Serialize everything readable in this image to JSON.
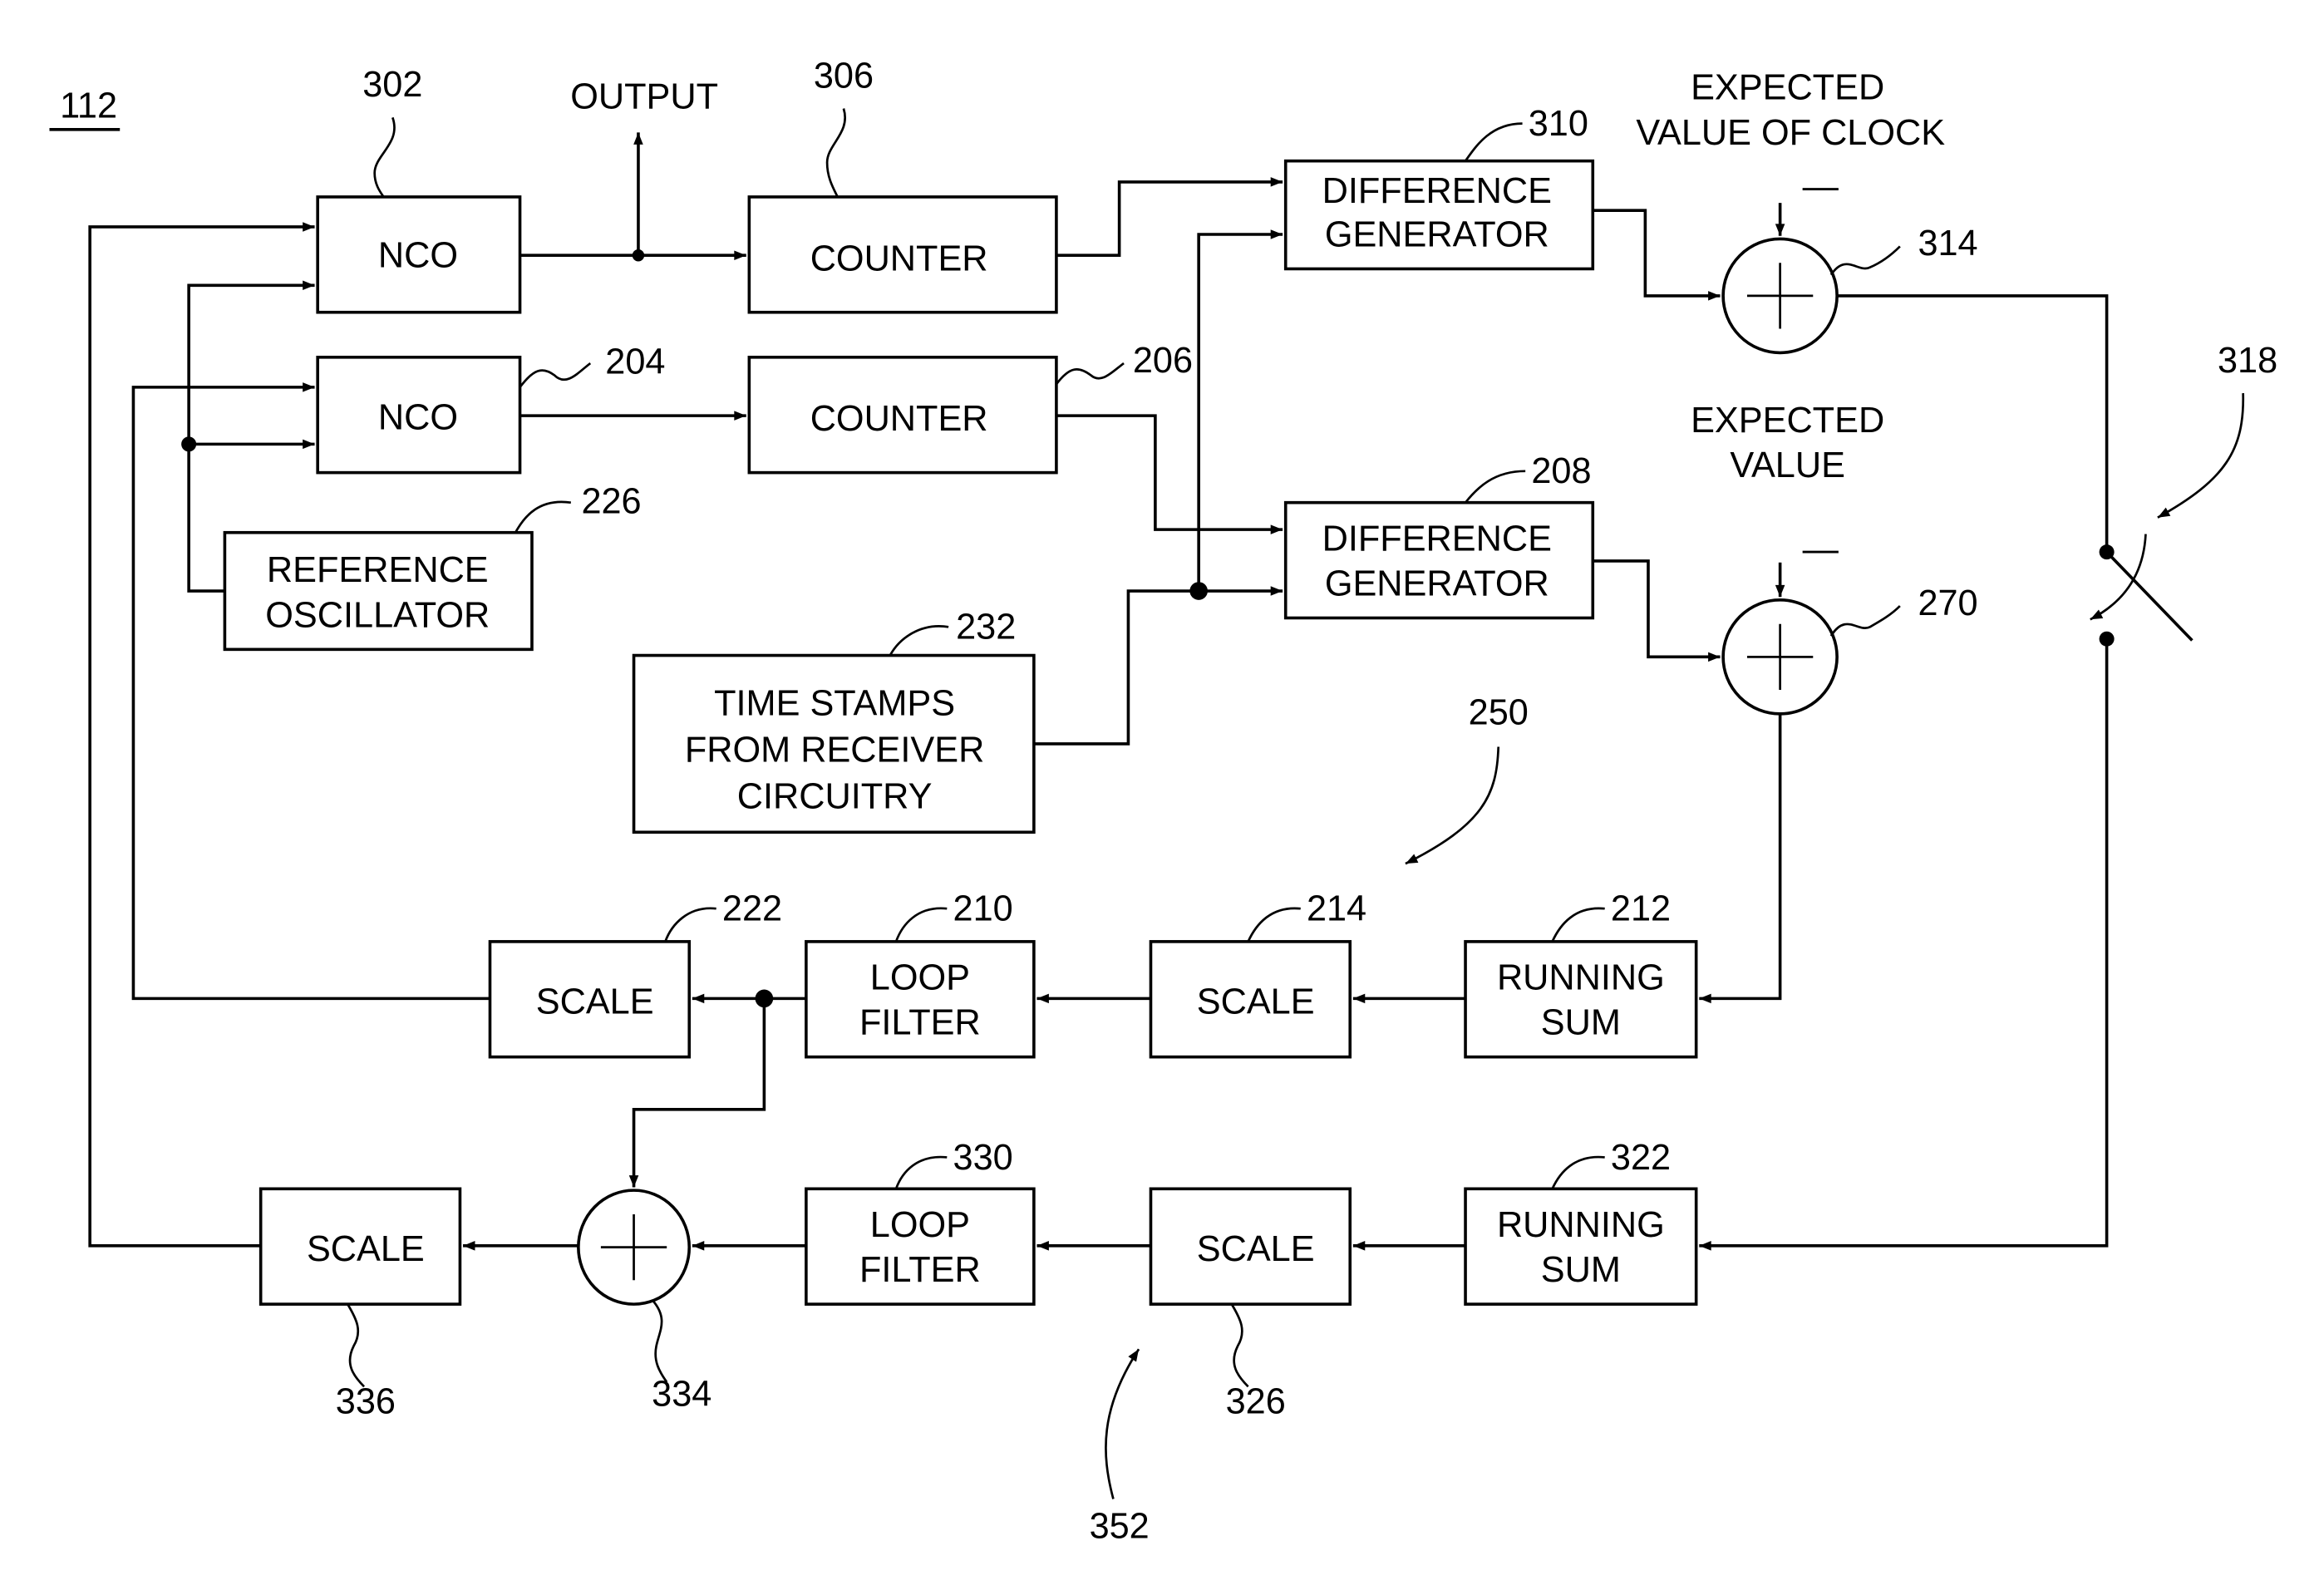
{
  "figure": {
    "id_label": "112",
    "output_label": "OUTPUT",
    "expected_value_of_clock": [
      "EXPECTED",
      "VALUE OF CLOCK"
    ],
    "expected_value": [
      "EXPECTED",
      "VALUE"
    ],
    "minus_sign": "—"
  },
  "blocks": {
    "nco_302": {
      "ref": "302",
      "lines": [
        "NCO"
      ]
    },
    "counter_306": {
      "ref": "306",
      "lines": [
        "COUNTER"
      ]
    },
    "diff_310": {
      "ref": "310",
      "lines": [
        "DIFFERENCE",
        "GENERATOR"
      ]
    },
    "nco_204": {
      "ref": "204",
      "lines": [
        "NCO"
      ]
    },
    "counter_206": {
      "ref": "206",
      "lines": [
        "COUNTER"
      ]
    },
    "diff_208": {
      "ref": "208",
      "lines": [
        "DIFFERENCE",
        "GENERATOR"
      ]
    },
    "refosc_226": {
      "ref": "226",
      "lines": [
        "REFERENCE",
        "OSCILLATOR"
      ]
    },
    "timestamps_232": {
      "ref": "232",
      "lines": [
        "TIME STAMPS",
        "FROM RECEIVER",
        "CIRCUITRY"
      ]
    },
    "scale_222": {
      "ref": "222",
      "lines": [
        "SCALE"
      ]
    },
    "loopfilter_210": {
      "ref": "210",
      "lines": [
        "LOOP",
        "FILTER"
      ]
    },
    "scale_214": {
      "ref": "214",
      "lines": [
        "SCALE"
      ]
    },
    "runsum_212": {
      "ref": "212",
      "lines": [
        "RUNNING",
        "SUM"
      ]
    },
    "scale_336": {
      "ref": "336",
      "lines": [
        "SCALE"
      ]
    },
    "loopfilter_330": {
      "ref": "330",
      "lines": [
        "LOOP",
        "FILTER"
      ]
    },
    "scale_326": {
      "ref": "326",
      "lines": [
        "SCALE"
      ]
    },
    "runsum_322": {
      "ref": "322",
      "lines": [
        "RUNNING",
        "SUM"
      ]
    }
  },
  "summers": {
    "sum_314": {
      "ref": "314"
    },
    "sum_270": {
      "ref": "270"
    },
    "sum_334": {
      "ref": "334"
    }
  },
  "switch": {
    "ref": "318"
  },
  "groups": {
    "loop_250": "250",
    "loop_352": "352"
  }
}
